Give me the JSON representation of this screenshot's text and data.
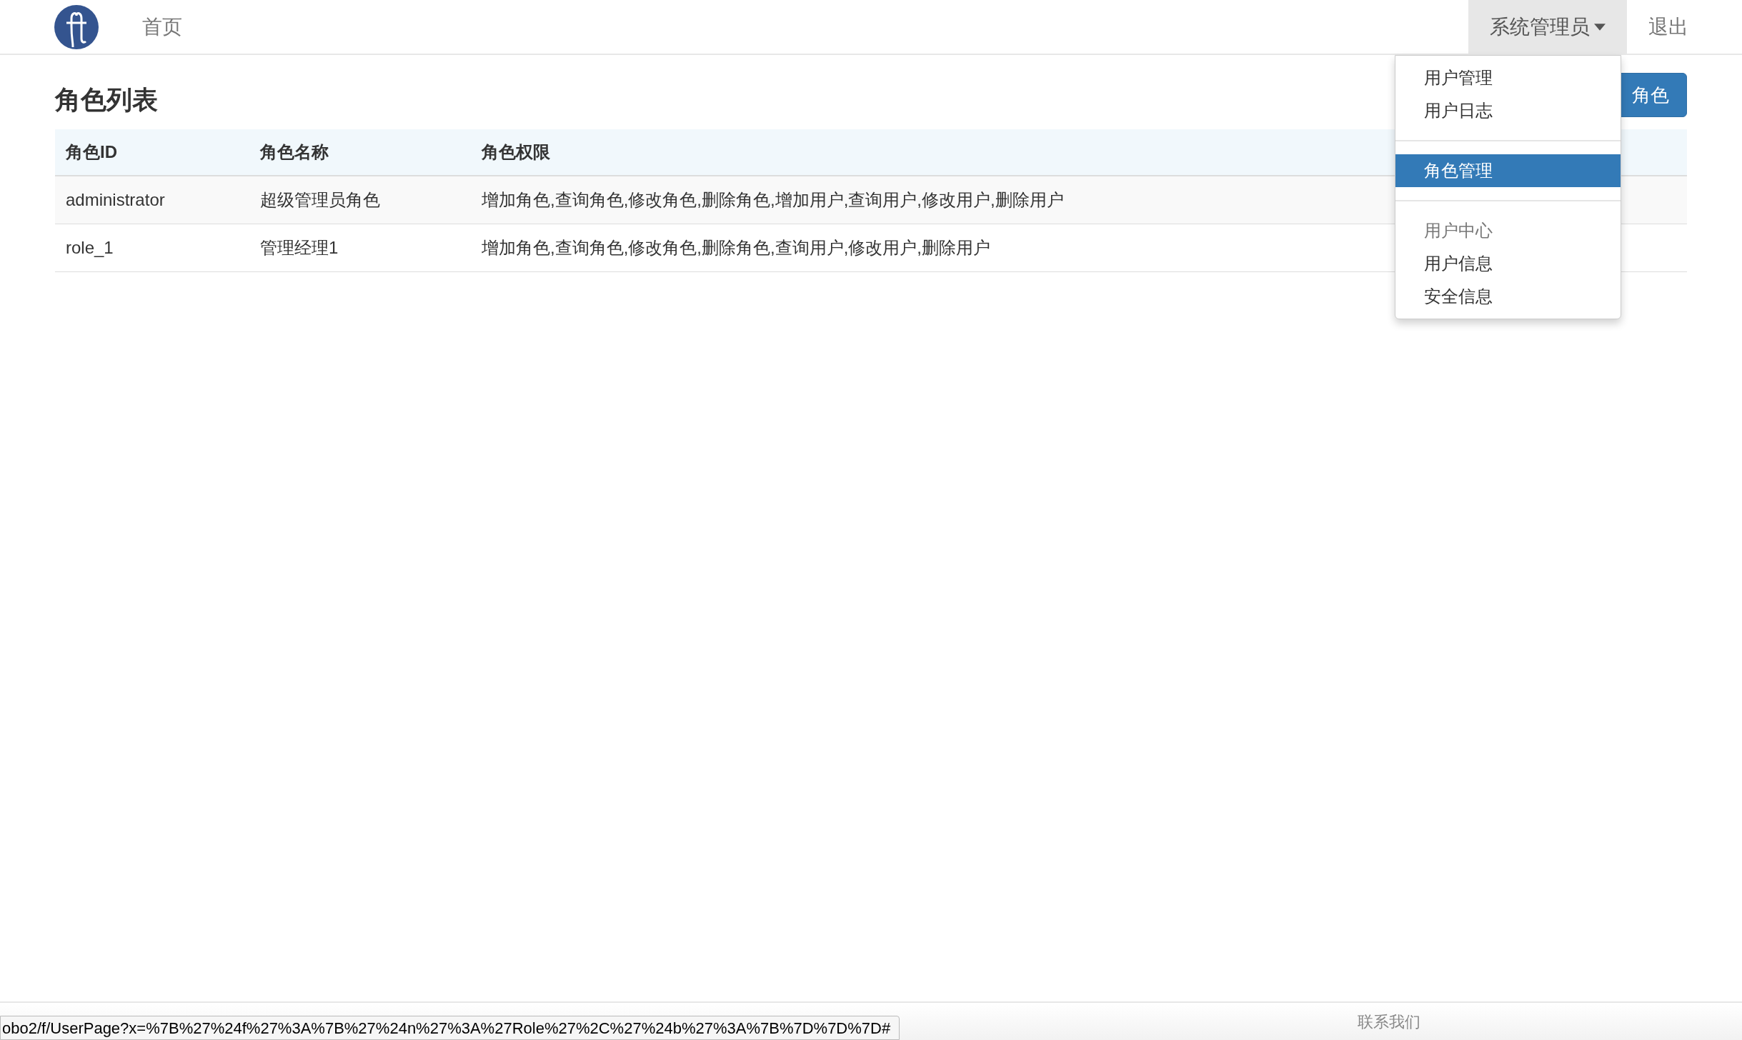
{
  "navbar": {
    "links": [
      {
        "label": "首页"
      }
    ],
    "user_menu": {
      "label": "系统管理员",
      "expanded": true
    },
    "logout": "退出"
  },
  "page": {
    "title": "角色列表",
    "add_button": "角色"
  },
  "table": {
    "columns": [
      "角色ID",
      "角色名称",
      "角色权限"
    ],
    "rows": [
      {
        "cells": [
          "administrator",
          "超级管理员角色",
          "增加角色,查询角色,修改角色,删除角色,增加用户,查询用户,修改用户,删除用户"
        ]
      },
      {
        "cells": [
          "role_1",
          "管理经理1",
          "增加角色,查询角色,修改角色,删除角色,查询用户,修改用户,删除用户"
        ]
      }
    ]
  },
  "dropdown": {
    "items": [
      {
        "kind": "item",
        "label": "用户管理",
        "selected": false
      },
      {
        "kind": "item",
        "label": "用户日志",
        "selected": false
      },
      {
        "kind": "divider"
      },
      {
        "kind": "item",
        "label": "角色管理",
        "selected": true
      },
      {
        "kind": "divider"
      },
      {
        "kind": "header",
        "label": "用户中心"
      },
      {
        "kind": "item",
        "label": "用户信息",
        "selected": false
      },
      {
        "kind": "item",
        "label": "安全信息",
        "selected": false
      }
    ]
  },
  "footer": {
    "contact": "联系我们"
  },
  "status_bar": {
    "url": "obo2/f/UserPage?x=%7B%27%24f%27%3A%7B%27%24n%27%3A%27Role%27%2C%27%24b%27%3A%7B%7D%7D%7D#"
  }
}
